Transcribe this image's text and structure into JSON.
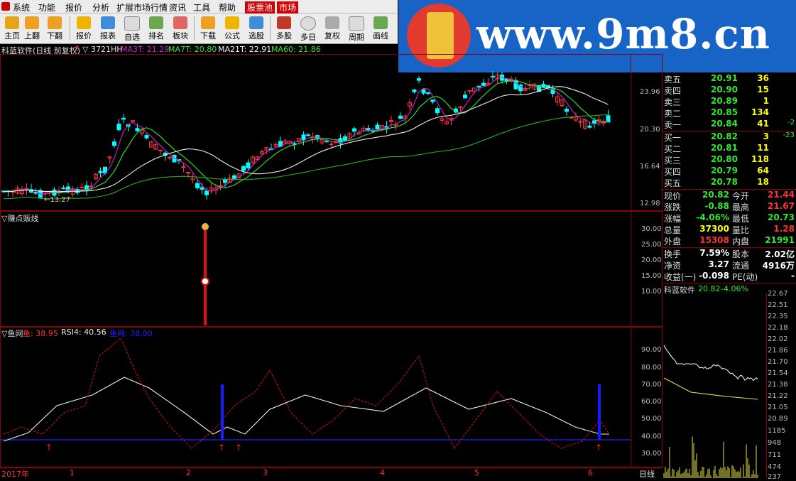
{
  "menu": {
    "items": [
      "系统",
      "功能",
      "报价",
      "分析",
      "扩展市场行情",
      "资讯",
      "工具",
      "帮助",
      "股票池",
      "市场"
    ],
    "highlighted": [
      "股票池",
      "市场"
    ]
  },
  "toolbar": {
    "buttons": [
      {
        "label": "主页",
        "icon": "home-icon",
        "color": "#e8a317"
      },
      {
        "label": "上翻",
        "icon": "up-arrow-icon",
        "color": "#f0a020"
      },
      {
        "label": "下翻",
        "icon": "down-arrow-icon",
        "color": "#f0a020"
      },
      {
        "label": "报价",
        "icon": "yen-icon",
        "color": "#f0b400"
      },
      {
        "label": "报表",
        "icon": "report-icon",
        "color": "#3c8edc"
      },
      {
        "label": "自选",
        "icon": "f6-icon",
        "color": "#dcdcdc"
      },
      {
        "label": "排名",
        "icon": "ranking-icon",
        "color": "#6aa84f"
      },
      {
        "label": "板块",
        "icon": "grid-icon",
        "color": "#e06666"
      },
      {
        "label": "下载",
        "icon": "download-icon",
        "color": "#f0a020"
      },
      {
        "label": "公式",
        "icon": "formula-icon",
        "color": "#f0b400"
      },
      {
        "label": "选股",
        "icon": "stock-pick-icon",
        "color": "#3c8edc"
      },
      {
        "label": "多股",
        "icon": "multi-stock-icon",
        "color": "#c0392b"
      },
      {
        "label": "多日",
        "icon": "clock-icon",
        "color": "#dcdcdc"
      },
      {
        "label": "复权",
        "icon": "restore-icon",
        "color": "#aaaaaa"
      },
      {
        "label": "周期",
        "icon": "f8-icon",
        "color": "#dcdcdc"
      },
      {
        "label": "画线",
        "icon": "draw-line-icon",
        "color": "#6aa84f"
      }
    ]
  },
  "banner": {
    "url_text": "www.9m8.cn"
  },
  "main_chart": {
    "title": "科蓝软件(日线 前复权)",
    "volume": "3721HH",
    "ma3": "MA3T: 21.29",
    "ma7": "MA7T: 20.80",
    "ma21": "MA21T: 22.91",
    "ma60": "MA60: 21.86",
    "low_annotation": "13.27",
    "y_ticks": [
      "23.96",
      "20.30",
      "16.64",
      "12.98"
    ]
  },
  "ind1": {
    "title": "赚点贩线",
    "y_ticks": [
      "30.00",
      "25.00",
      "20.00",
      "15.00",
      "10.00"
    ]
  },
  "ind2": {
    "title": "鱼网",
    "fish_label": "鱼: 38.95",
    "rsi_label": "RSI4: 40.56",
    "net_label": "鱼网: 38.00",
    "y_ticks": [
      "90.00",
      "80.00",
      "70.00",
      "60.00",
      "50.00",
      "40.00",
      "30.00"
    ]
  },
  "x_axis": {
    "labels": [
      "2017年",
      "1",
      "2",
      "3",
      "4",
      "5",
      "6"
    ],
    "period": "日线"
  },
  "order_book": {
    "asks": [
      {
        "name": "卖五",
        "price": "20.91",
        "vol": "36",
        "chg": ""
      },
      {
        "name": "卖四",
        "price": "20.90",
        "vol": "15",
        "chg": ""
      },
      {
        "name": "卖三",
        "price": "20.89",
        "vol": "1",
        "chg": ""
      },
      {
        "name": "卖二",
        "price": "20.85",
        "vol": "134",
        "chg": ""
      },
      {
        "name": "卖一",
        "price": "20.84",
        "vol": "41",
        "chg": "-2"
      }
    ],
    "bids": [
      {
        "name": "买一",
        "price": "20.82",
        "vol": "3",
        "chg": "-23"
      },
      {
        "name": "买二",
        "price": "20.81",
        "vol": "11",
        "chg": ""
      },
      {
        "name": "买三",
        "price": "20.80",
        "vol": "118",
        "chg": ""
      },
      {
        "name": "买四",
        "price": "20.79",
        "vol": "64",
        "chg": ""
      },
      {
        "name": "买五",
        "price": "20.78",
        "vol": "18",
        "chg": ""
      }
    ]
  },
  "quote": [
    {
      "l": "现价",
      "lv": "20.82",
      "lc": "green",
      "r": "今开",
      "rv": "21.44",
      "rc": "red"
    },
    {
      "l": "涨跌",
      "lv": "-0.88",
      "lc": "green",
      "r": "最高",
      "rv": "21.67",
      "rc": "red"
    },
    {
      "l": "涨幅",
      "lv": "-4.06%",
      "lc": "green",
      "r": "最低",
      "rv": "20.73",
      "rc": "green"
    },
    {
      "l": "总量",
      "lv": "37300",
      "lc": "yellow",
      "r": "量比",
      "rv": "1.28",
      "rc": "red"
    },
    {
      "l": "外盘",
      "lv": "15308",
      "lc": "red",
      "r": "内盘",
      "rv": "21991",
      "rc": "green"
    },
    {
      "l": "换手",
      "lv": "7.59%",
      "lc": "white",
      "r": "股本",
      "rv": "2.02亿",
      "rc": "white"
    },
    {
      "l": "净资",
      "lv": "3.27",
      "lc": "white",
      "r": "流通",
      "rv": "4916万",
      "rc": "white"
    },
    {
      "l": "收益(一)",
      "lv": "-0.098",
      "lc": "white",
      "r": "PE(动)",
      "rv": "-",
      "rc": "white"
    }
  ],
  "mini": {
    "name": "科蓝软件",
    "price": "20.82",
    "pct": "-4.06%",
    "price_ticks": [
      "22.67",
      "22.51",
      "22.35",
      "22.18",
      "22.02",
      "21.86",
      "21.70",
      "21.54",
      "21.38",
      "21.22",
      "21.05",
      "20.89"
    ],
    "vol_ticks": [
      "1185",
      "948",
      "711",
      "474",
      "237"
    ]
  },
  "colors": {
    "up": "#ff3232",
    "down": "#00ffff",
    "ma_white": "#eeeeee",
    "ma_green": "#2fe82f",
    "ma_purple": "#d020d0",
    "frame": "#8b0000",
    "signal_blue": "#2020ff"
  }
}
